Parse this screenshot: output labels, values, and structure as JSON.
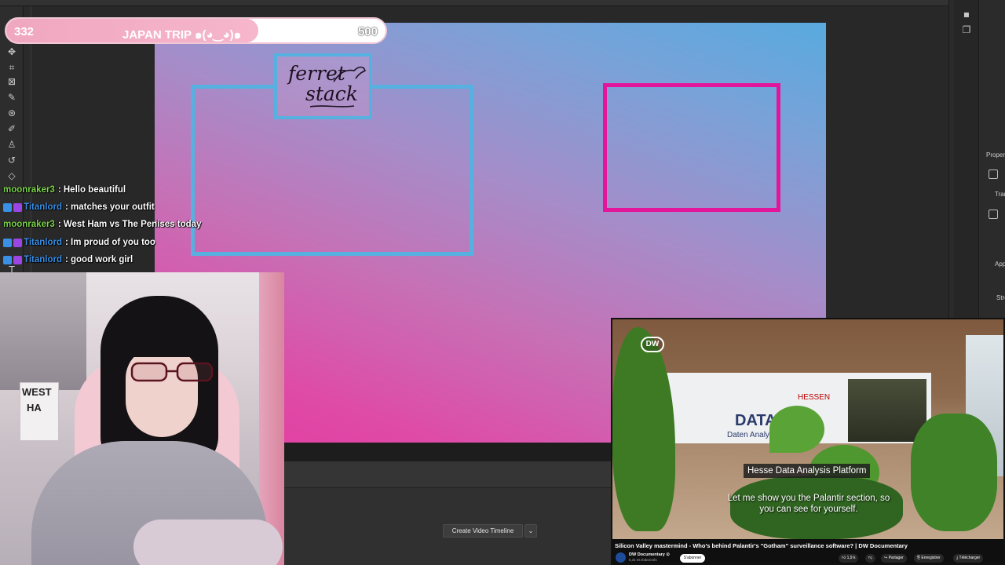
{
  "goal": {
    "current": "332",
    "title": "JAPAN TRIP ๑(◕‿◕)๑",
    "target": "500",
    "progress_fraction": 0.664
  },
  "canvas": {
    "logo_line1": "ferret",
    "logo_line2": "stack"
  },
  "chat": [
    {
      "user": "moonraker3",
      "message": ": Hello beautiful",
      "color": "#7cd44a",
      "badge": false
    },
    {
      "user": "Titanlord",
      "message": ": matches your outfit",
      "color": "#3a8fe6",
      "badge": true
    },
    {
      "user": "moonraker3",
      "message": ": West Ham vs The Penises today",
      "color": "#7cd44a",
      "badge": false
    },
    {
      "user": "Titanlord",
      "message": ": Im proud of you too",
      "color": "#3a8fe6",
      "badge": true
    },
    {
      "user": "Titanlord",
      "message": ": good work girl",
      "color": "#3a8fe6",
      "badge": true
    }
  ],
  "webcam": {
    "poster_line1": "WEST",
    "poster_line2": "HA"
  },
  "photoshop": {
    "timeline_button": "Create Video Timeline",
    "timeline_caret": "⌄",
    "panel_labels": [
      "Proper",
      "Tran",
      "App",
      "Stro"
    ]
  },
  "video": {
    "channel_logo": "DW",
    "banner_main": "DATA",
    "banner_brand": "HESSEN",
    "banner_sub": "Daten Analyseplattform",
    "location_label": "Hesse Data Analysis Platform",
    "subtitle": "Let me show you the Palantir section, so you can see for yourself.",
    "title": "Silicon Valley mastermind - Who's behind Palantir's \"Gotham\" surveillance software? | DW Documentary",
    "channel_name": "DW Documentary ⊙",
    "channel_subs": "6,31 M d'abonnés",
    "subscribe": "S'abonner",
    "likes": "1,9 k",
    "share": "Partager",
    "save": "Enregistrer",
    "download": "Télécharger"
  },
  "colors": {
    "goal_fill": "#f0a7c0",
    "canvas_pink": "#e33c9f",
    "canvas_blue": "#58aadf",
    "frame_blue": "#56b1e0",
    "frame_pink": "#e3159a"
  }
}
